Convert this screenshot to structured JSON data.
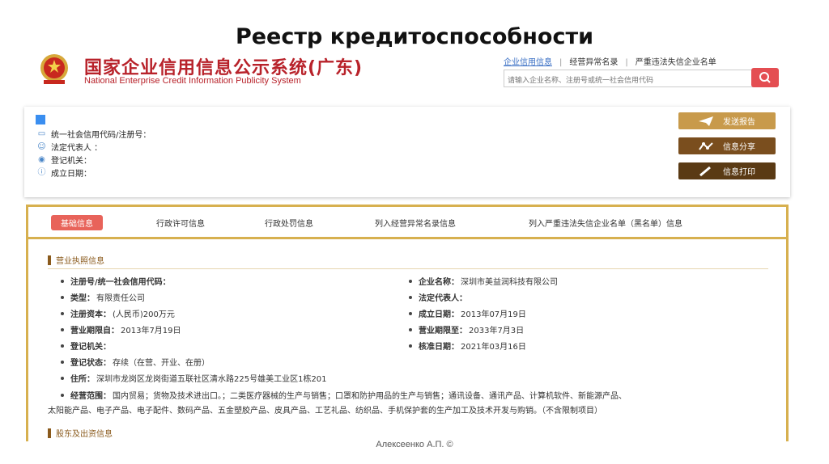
{
  "slide": {
    "title": "Реестр кредитоспособности",
    "footer": "Алексеенко А.П. ©"
  },
  "header": {
    "logo_cn": "国家企业信用信息公示系统(广东)",
    "logo_en": "National Enterprise Credit Information Publicity System",
    "links": [
      "企业信用信息",
      "经营异常名录",
      "严重违法失信企业名单"
    ],
    "search_placeholder": "请输入企业名称、注册号或统一社会信用代码"
  },
  "summary": {
    "fields": [
      "统一社会信用代码/注册号：",
      "法定代表人 ：",
      "登记机关：",
      "成立日期："
    ],
    "buttons": [
      "发送报告",
      "信息分享",
      "信息打印"
    ]
  },
  "tabs": [
    "基础信息",
    "行政许可信息",
    "行政处罚信息",
    "列入经营异常名录信息",
    "列入严重违法失信企业名单（黑名单）信息"
  ],
  "license": {
    "title": "营业执照信息",
    "left": [
      {
        "label": "注册号/统一社会信用代码：",
        "value": ""
      },
      {
        "label": "类型：",
        "value": "有限责任公司"
      },
      {
        "label": "注册资本：",
        "value": "(人民币)200万元"
      },
      {
        "label": "营业期限自：",
        "value": "2013年7月19日"
      },
      {
        "label": "登记机关：",
        "value": ""
      },
      {
        "label": "登记状态：",
        "value": "存续（在营、开业、在册）"
      },
      {
        "label": "住所：",
        "value": "深圳市龙岗区龙岗街道五联社区清水路225号雄美工业区1栋201"
      }
    ],
    "right": [
      {
        "label": "企业名称：",
        "value": "深圳市美益润科技有限公司"
      },
      {
        "label": "法定代表人：",
        "value": ""
      },
      {
        "label": "成立日期：",
        "value": "2013年07月19日"
      },
      {
        "label": "营业期限至：",
        "value": "2033年7月3日"
      },
      {
        "label": "核准日期：",
        "value": "2021年03月16日"
      }
    ],
    "scope_label": "经营范围：",
    "scope_line1": "国内贸易；货物及技术进出口。；二类医疗器械的生产与销售；口罩和防护用品的生产与销售；通讯设备、通讯产品、计算机软件、新能源产品、",
    "scope_line2": "太阳能产品、电子产品、电子配件、数码产品、五金塑胶产品、皮具产品、工艺礼品、纺织品、手机保护套的生产加工及技术开发与购销。（不含限制项目）"
  },
  "shareholders": {
    "title": "股东及出资信息"
  },
  "colors": {
    "brand_red": "#b8222a",
    "gold": "#d7b04f",
    "button_tan": "#c89a4b",
    "button_brown": "#7a4e1e",
    "button_dark": "#5a3a14",
    "tab_active": "#e8635a",
    "search_btn": "#e44e52"
  },
  "icons": [
    "emblem-icon",
    "search-icon",
    "flag-icon",
    "book-icon",
    "person-icon",
    "location-icon",
    "info-icon",
    "send-icon",
    "share-icon",
    "print-icon",
    "bullet-icon"
  ]
}
